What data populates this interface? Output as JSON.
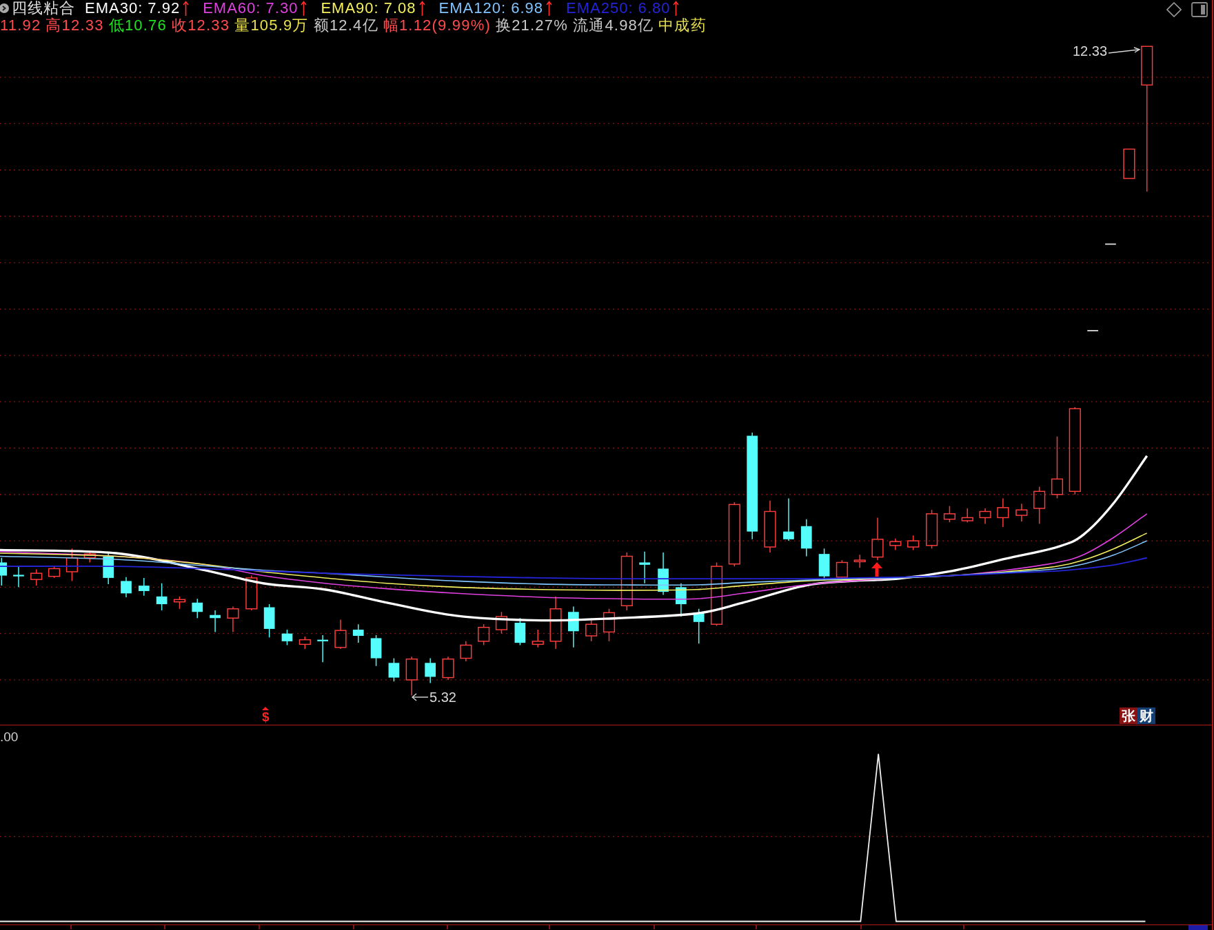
{
  "title": "四线粘合",
  "indicators": [
    {
      "label": "EMA30: 7.92",
      "color": "#ffffff",
      "rising": true
    },
    {
      "label": "EMA60: 7.30",
      "color": "#e040e0",
      "rising": true
    },
    {
      "label": "EMA90: 7.08",
      "color": "#f4f060",
      "rising": true
    },
    {
      "label": "EMA120: 6.98",
      "color": "#80c4ff",
      "rising": true
    },
    {
      "label": "EMA250: 6.80",
      "color": "#2424d8",
      "rising": true
    }
  ],
  "quote": [
    {
      "text": "11.92",
      "color": "#ff4c4c"
    },
    {
      "text": "高12.33",
      "color": "#ff4c4c"
    },
    {
      "text": "低10.76",
      "color": "#22e022"
    },
    {
      "text": "收12.33",
      "color": "#ff4c4c"
    },
    {
      "text": "量105.9万",
      "color": "#e8e050"
    },
    {
      "text": "额12.4亿",
      "color": "#c8c8c8"
    },
    {
      "text": "幅1.12(9.99%)",
      "color": "#ff4c4c"
    },
    {
      "text": "换21.27%",
      "color": "#c8c8c8"
    },
    {
      "text": "流通4.98亿",
      "color": "#c8c8c8"
    },
    {
      "text": "中成药",
      "color": "#e8e050"
    }
  ],
  "price_chart": {
    "high_label": "12.33",
    "low_label": "5.32",
    "signal_mark": "$",
    "tag": [
      {
        "text": "张",
        "color": "#8a1212"
      },
      {
        "text": "财",
        "color": "#143f72"
      }
    ]
  },
  "indicator_panel": {
    "scale_label": ".00"
  }
}
